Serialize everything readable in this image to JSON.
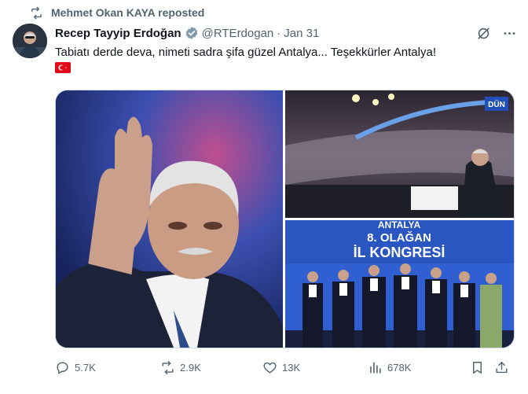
{
  "repost": {
    "text": "Mehmet Okan KAYA reposted"
  },
  "tweet": {
    "author_name": "Recep Tayyip Erdoğan",
    "handle": "@RTErdogan",
    "separator": "·",
    "date": "Jan 31",
    "text": "Tabiatı derde deva, nimeti sadra şifa güzel Antalya... Teşekkürler Antalya!",
    "flag_icon": "turkey-flag"
  },
  "media": {
    "banner_line1": "ANTALYA",
    "banner_line2": "8. OLAĞAN",
    "banner_line3": "İL KONGRESİ",
    "arena_sign": "DÜN"
  },
  "actions": {
    "replies": "5.7K",
    "reposts": "2.9K",
    "likes": "13K",
    "views": "678K"
  },
  "colors": {
    "secondary_text": "#536471",
    "verified_badge": "#829aab",
    "flag_red": "#e30a17"
  }
}
